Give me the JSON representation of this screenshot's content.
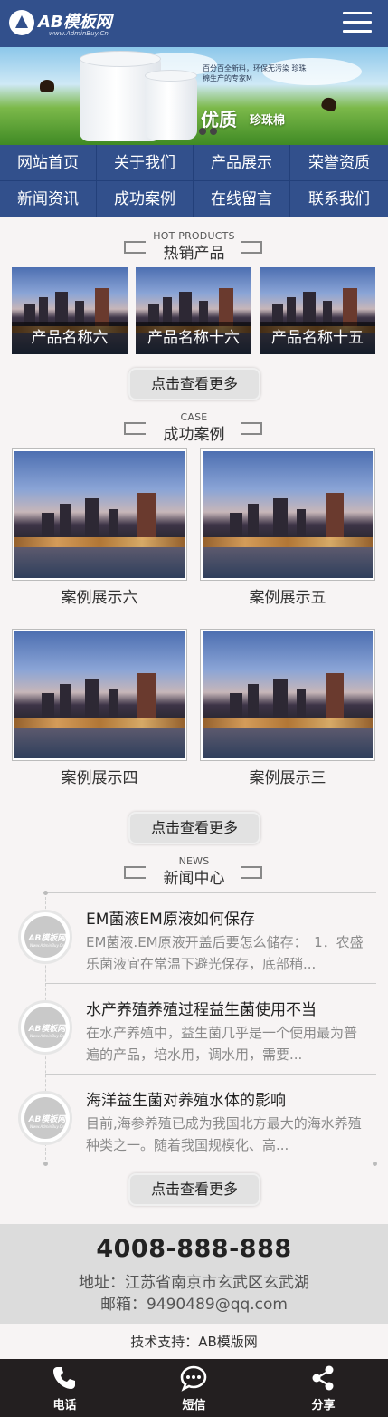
{
  "header": {
    "logo_title": "AB模板网",
    "logo_subtitle": "www.AdminBuy.Cn",
    "menu_icon": "menu-icon"
  },
  "banner": {
    "text": "百分百全新料，环保无污染 珍珠棉生产的专家M",
    "big": "优质",
    "small": "珍珠棉"
  },
  "nav": {
    "items": [
      "网站首页",
      "关于我们",
      "产品展示",
      "荣誉资质",
      "新闻资讯",
      "成功案例",
      "在线留言",
      "联系我们"
    ]
  },
  "hot_products": {
    "title_en": "HOT PRODUCTS",
    "title_cn": "热销产品",
    "items": [
      "产品名称六",
      "产品名称十六",
      "产品名称十五"
    ],
    "more": "点击查看更多"
  },
  "cases": {
    "title_en": "CASE",
    "title_cn": "成功案例",
    "items": [
      "案例展示六",
      "案例展示五",
      "案例展示四",
      "案例展示三"
    ],
    "more": "点击查看更多"
  },
  "news": {
    "title_en": "NEWS",
    "title_cn": "新闻中心",
    "thumb_logo": "AB模板网",
    "thumb_sub": "Www.AdminBuy.Cn",
    "items": [
      {
        "title": "EM菌液EM原液如何保存",
        "desc": "EM菌液.EM原液开盖后要怎么储存：　1．农盛乐菌液宜在常温下避光保存，底部稍..."
      },
      {
        "title": "水产养殖养殖过程益生菌使用不当",
        "desc": "在水产养殖中，益生菌几乎是一个使用最为普遍的产品，培水用，调水用，需要..."
      },
      {
        "title": "海洋益生菌对养殖水体的影响",
        "desc": "目前,海参养殖已成为我国北方最大的海水养殖种类之一。随着我国规模化、高..."
      }
    ],
    "more": "点击查看更多"
  },
  "footer": {
    "phone": "4008-888-888",
    "address": "地址：江苏省南京市玄武区玄武湖",
    "email": "邮箱：9490489@qq.com",
    "support": "技术支持：AB模版网"
  },
  "bottom_bar": {
    "items": [
      {
        "label": "电话",
        "icon": "phone-icon"
      },
      {
        "label": "短信",
        "icon": "message-icon"
      },
      {
        "label": "分享",
        "icon": "share-icon"
      }
    ]
  },
  "colors": {
    "brand": "#32508c",
    "bottom_bar": "#231f20",
    "contact_bg": "#dcdcdc"
  }
}
